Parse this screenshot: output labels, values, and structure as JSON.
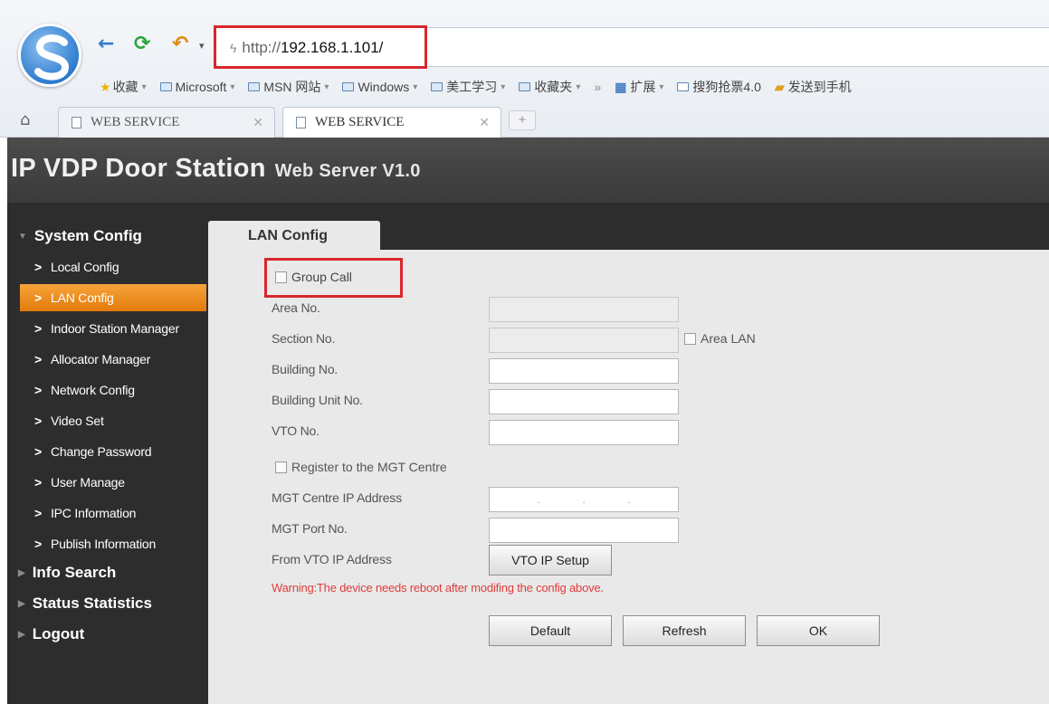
{
  "browser": {
    "address": {
      "prefix": "http://",
      "host": "192.168.1.101/"
    },
    "bookmarks": [
      {
        "label": "收藏",
        "icon": "star-icon"
      },
      {
        "label": "Microsoft",
        "icon": "folder-icon"
      },
      {
        "label": "MSN 网站",
        "icon": "folder-icon"
      },
      {
        "label": "Windows",
        "icon": "folder-icon"
      },
      {
        "label": "美工学习",
        "icon": "folder-icon"
      },
      {
        "label": "收藏夹",
        "icon": "folder-icon"
      },
      {
        "label": "»",
        "icon": ""
      },
      {
        "label": "扩展",
        "icon": "extension-icon"
      },
      {
        "label": "搜狗抢票4.0",
        "icon": "page-icon"
      },
      {
        "label": "发送到手机",
        "icon": "phone-icon"
      }
    ],
    "tabs": [
      {
        "title": "WEB SERVICE"
      },
      {
        "title": "WEB SERVICE"
      }
    ],
    "new_tab": "+"
  },
  "header": {
    "title": "IP VDP Door Station",
    "subtitle": "Web Server V1.0"
  },
  "sidebar": {
    "groups": {
      "system_config": "System Config",
      "info_search": "Info Search",
      "status_statistics": "Status Statistics",
      "logout": "Logout"
    },
    "items": [
      {
        "label": "Local Config"
      },
      {
        "label": "LAN Config"
      },
      {
        "label": "Indoor Station Manager"
      },
      {
        "label": "Allocator Manager"
      },
      {
        "label": "Network Config"
      },
      {
        "label": "Video Set"
      },
      {
        "label": "Change Password"
      },
      {
        "label": "User Manage"
      },
      {
        "label": "IPC Information"
      },
      {
        "label": "Publish Information"
      }
    ],
    "active_item": "LAN Config"
  },
  "content": {
    "tab": "LAN Config",
    "group_call": {
      "label": "Group Call",
      "checked": false
    },
    "area_lan": {
      "label": "Area LAN",
      "checked": false
    },
    "register_mgt": {
      "label": "Register to the MGT Centre",
      "checked": false
    },
    "fields": {
      "area_no": {
        "label": "Area No.",
        "value": "",
        "disabled": true
      },
      "section_no": {
        "label": "Section No.",
        "value": "",
        "disabled": true
      },
      "building_no": {
        "label": "Building No.",
        "value": ""
      },
      "building_unit_no": {
        "label": "Building Unit No.",
        "value": ""
      },
      "vto_no": {
        "label": "VTO No.",
        "value": ""
      },
      "mgt_ip": {
        "label": "MGT Centre IP Address",
        "value": ""
      },
      "mgt_port": {
        "label": "MGT Port No.",
        "value": ""
      },
      "from_vto_ip": {
        "label": "From VTO IP Address"
      }
    },
    "ip_dots": [
      ".",
      ".",
      "."
    ],
    "vto_ip_setup_button": "VTO IP Setup",
    "warning": "Warning:The device needs reboot after modifing the config above.",
    "buttons": {
      "default": "Default",
      "refresh": "Refresh",
      "ok": "OK"
    }
  },
  "colors": {
    "accent": "#f29a28",
    "highlight": "#d9272e",
    "warning": "#e03c3c"
  }
}
